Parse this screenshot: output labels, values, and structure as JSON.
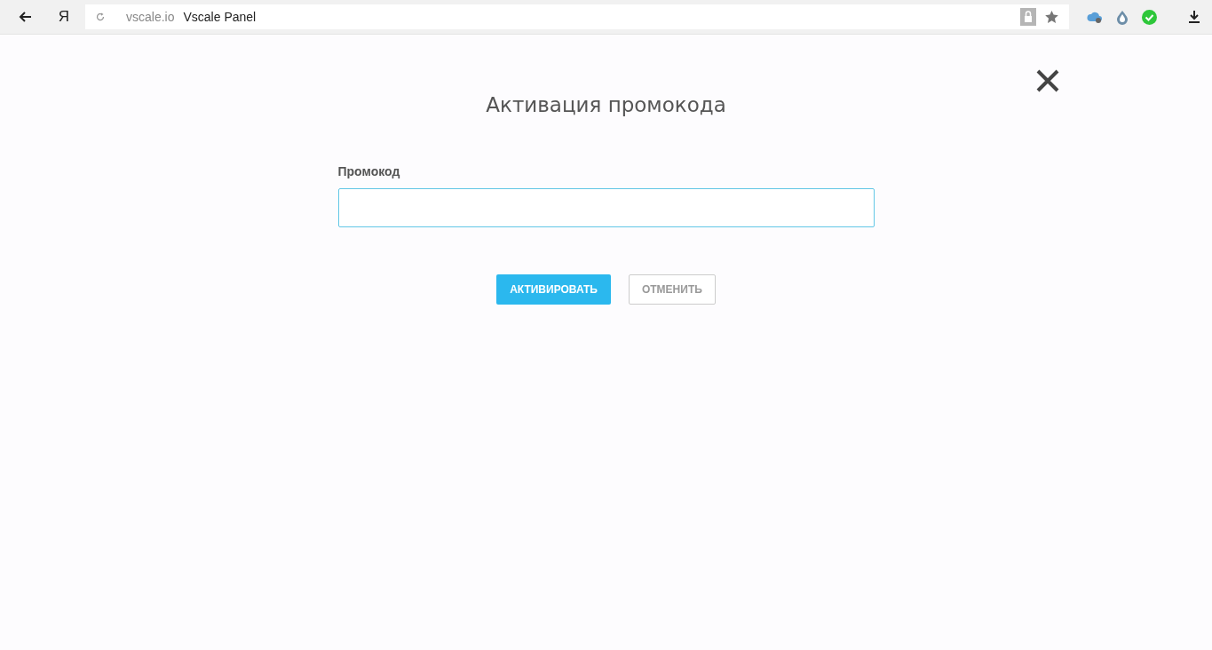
{
  "browser": {
    "logo": "Я",
    "domain": "vscale.io",
    "page_title": "Vscale Panel"
  },
  "dialog": {
    "title": "Активация промокода",
    "field": {
      "label": "Промокод",
      "focused": true
    },
    "buttons": [
      {
        "label": "АКТИВИРОВАТЬ",
        "kind": "primary"
      },
      {
        "label": "ОТМЕНИТЬ",
        "kind": "secondary"
      }
    ]
  }
}
